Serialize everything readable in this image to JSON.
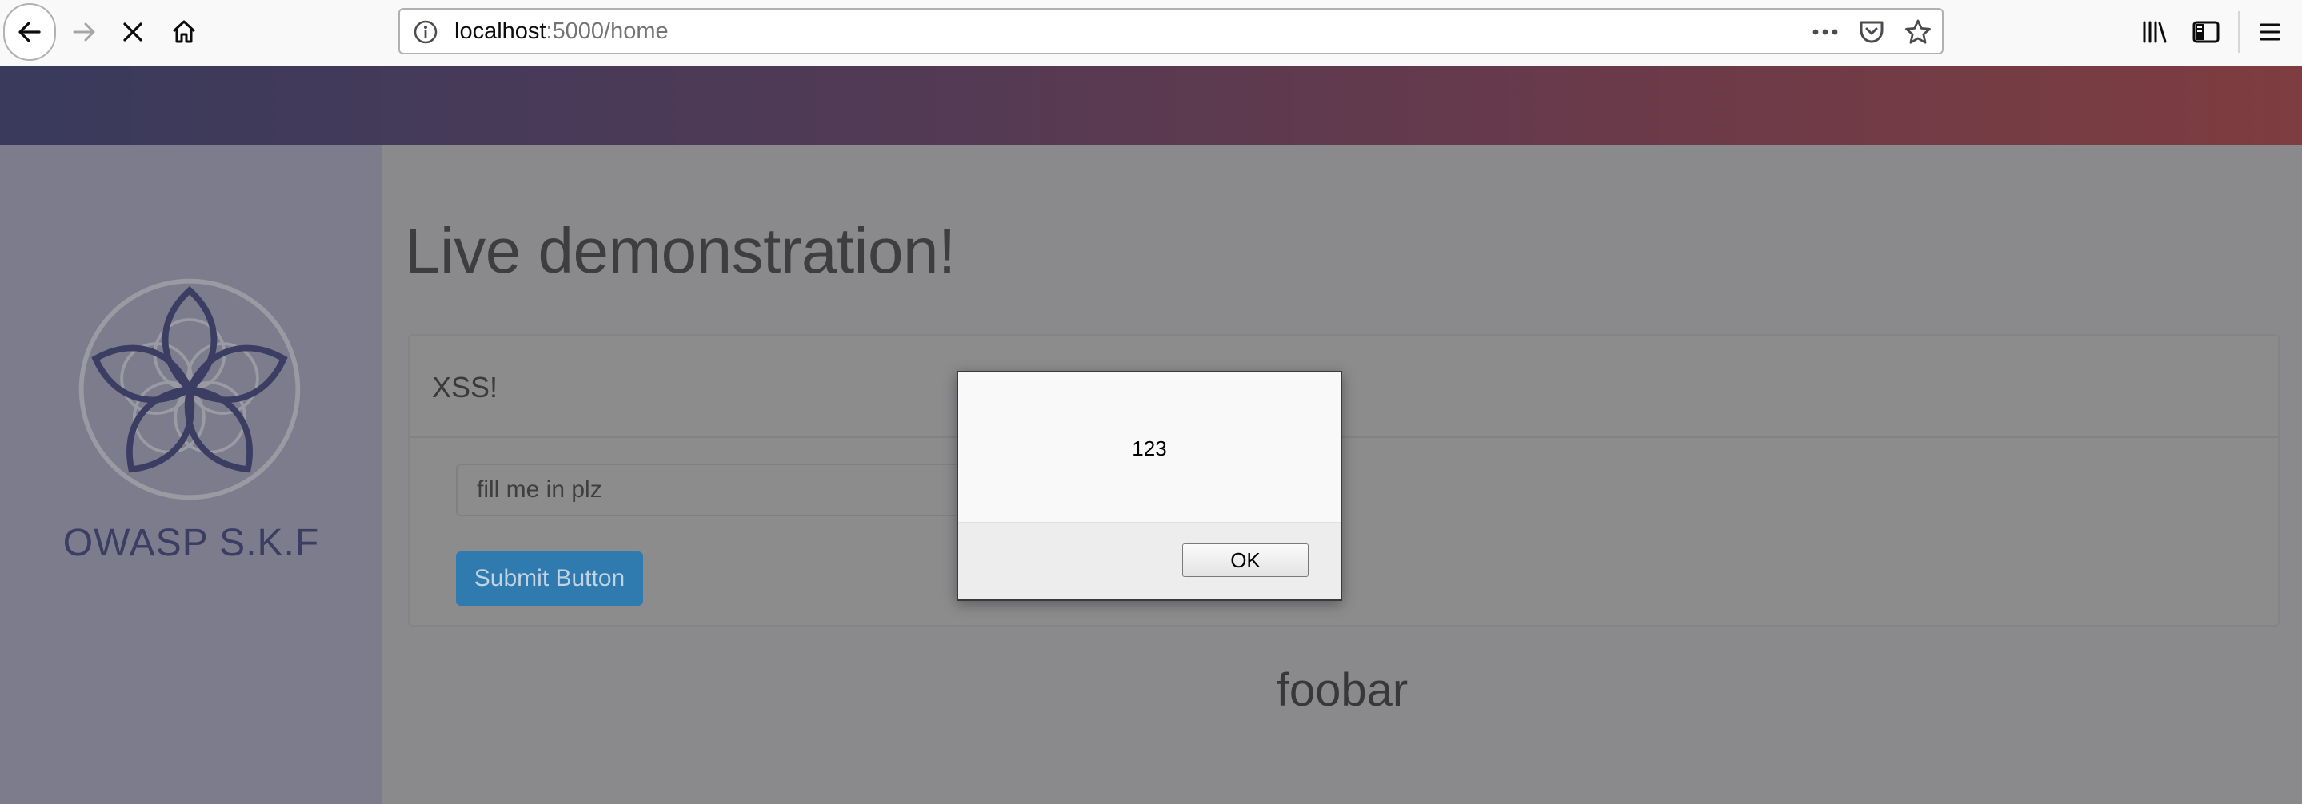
{
  "browser": {
    "url_host": "localhost",
    "url_rest": ":5000/home",
    "icons": [
      "back-arrow-icon",
      "forward-arrow-icon",
      "stop-icon",
      "home-icon",
      "info-icon",
      "more-icon",
      "pocket-icon",
      "bookmark-star-icon",
      "library-icon",
      "sidebar-icon",
      "menu-icon"
    ]
  },
  "sidebar": {
    "logo_text": "OWASP S.K.F"
  },
  "main": {
    "title": "Live demonstration!",
    "panel_title": "XSS!",
    "input_placeholder": "fill me in plz",
    "submit_label": "Submit Button",
    "result_text": "foobar"
  },
  "alert": {
    "message": "123",
    "ok_label": "OK"
  },
  "colors": {
    "banner_start": "#393a5c",
    "banner_end": "#7e3d40",
    "sidebar": "#7c7c8c",
    "content_overlay": "#8a8a8c",
    "submit_button": "#2f7aae",
    "logo": "#3b3d62"
  }
}
